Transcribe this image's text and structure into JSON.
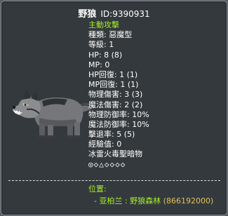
{
  "monster": {
    "name": "野狼",
    "id_text": "ID:9390931",
    "behavior": "主動攻擊",
    "type": "種類: 惡魔型",
    "level": "等級: 1",
    "hp": "HP: 8 (8)",
    "mp": "MP: 0",
    "hp_regen": "HP回復: 1 (1)",
    "mp_regen": "MP回復: 1 (1)",
    "phys_dmg": "物理傷害: 3 (3)",
    "magic_dmg": "魔法傷害: 2 (2)",
    "phys_def": "物理防御率: 10%",
    "magic_def": "魔法防御率: 10%",
    "knockback": "擊退率: 5 (5)",
    "exp": "經驗值: 0",
    "elements": "冰雷火毒聖暗物",
    "element_marks": "◎◇△◇◇◇◇"
  },
  "location": {
    "label": "位置:",
    "region": "亚柏兰",
    "map": "野狼森林",
    "map_id": "(866192000)"
  },
  "colors": {
    "highlight": "#a9f02b",
    "map_id": "#e2c25a",
    "panel": "#34393d"
  },
  "icons": {
    "monster": "wolf-image"
  }
}
